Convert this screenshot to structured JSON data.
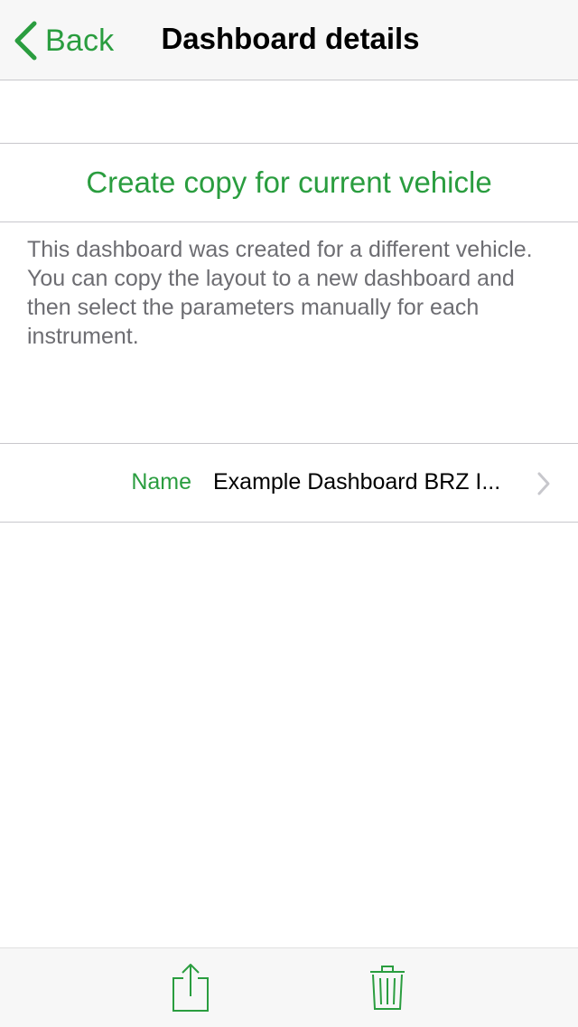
{
  "navbar": {
    "back_label": "Back",
    "title": "Dashboard details"
  },
  "copy_section": {
    "button_label": "Create copy for current vehicle",
    "footer_lines": [
      "This dashboard was created for a different vehicle.",
      "You can copy the layout to a new dashboard and then select the parameters manually for each instrument."
    ]
  },
  "name_row": {
    "label": "Name",
    "value": "Example Dashboard BRZ I..."
  },
  "toolbar": {
    "icons": [
      "share-icon",
      "trash-icon"
    ]
  },
  "colors": {
    "accent": "#2a9d3f",
    "bar_background": "#f7f7f7",
    "separator": "#c8c7cc",
    "footer_text": "#6d6d72"
  }
}
